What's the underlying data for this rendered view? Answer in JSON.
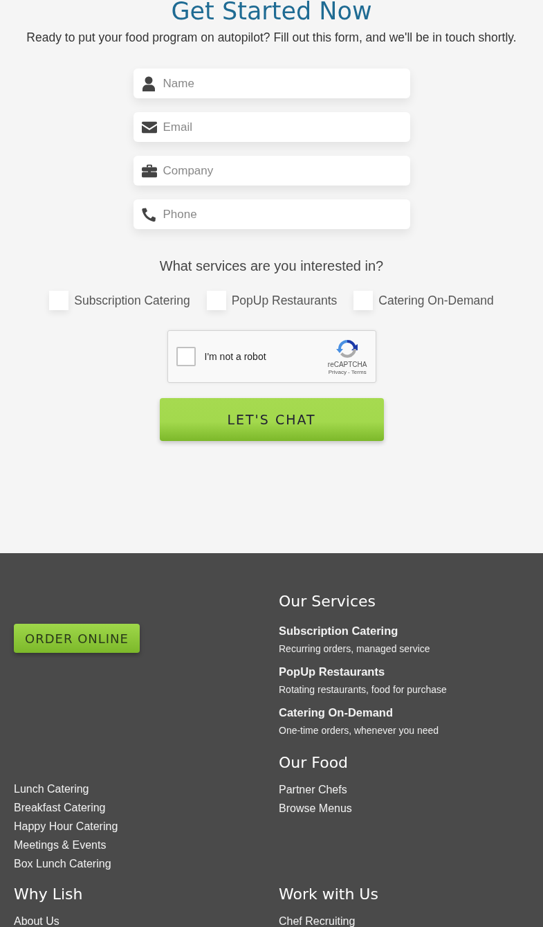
{
  "heading": "Get Started Now",
  "intro": "Ready to put your food program on autopilot? Fill out this form, and we'll be in touch shortly.",
  "fields": [
    {
      "placeholder": "Name",
      "kind": "name"
    },
    {
      "placeholder": "Email",
      "kind": "email"
    },
    {
      "placeholder": "Company",
      "kind": "company"
    },
    {
      "placeholder": "Phone",
      "kind": "phone"
    }
  ],
  "services_question": "What services are you interested in?",
  "services": [
    {
      "label": "Subscription Catering",
      "checked": false
    },
    {
      "label": "PopUp Restaurants",
      "checked": false
    },
    {
      "label": "Catering On-Demand",
      "checked": false
    }
  ],
  "captcha": {
    "label": "I'm not a robot",
    "checked": false,
    "brand": "reCAPTCHA",
    "links": "Privacy - Terms"
  },
  "submit": "LET'S CHAT",
  "footer": {
    "order_button": "ORDER ONLINE",
    "catering_links": [
      "Lunch Catering",
      "Breakfast Catering",
      "Happy Hour Catering",
      "Meetings & Events",
      "Box Lunch Catering"
    ],
    "services": {
      "title": "Our Services",
      "items": [
        {
          "name": "Subscription Catering",
          "description": "Recurring orders, managed service"
        },
        {
          "name": "PopUp Restaurants",
          "description": "Rotating restaurants, food for purchase"
        },
        {
          "name": "Catering On-Demand",
          "description": "One-time orders, whenever you need"
        }
      ]
    },
    "food": {
      "title": "Our Food",
      "links": [
        "Partner Chefs",
        "Browse Menus"
      ]
    },
    "why": {
      "title": "Why Lish",
      "links": [
        "About Us"
      ]
    },
    "work": {
      "title": "Work with Us",
      "links": [
        "Chef Recruiting"
      ]
    }
  }
}
